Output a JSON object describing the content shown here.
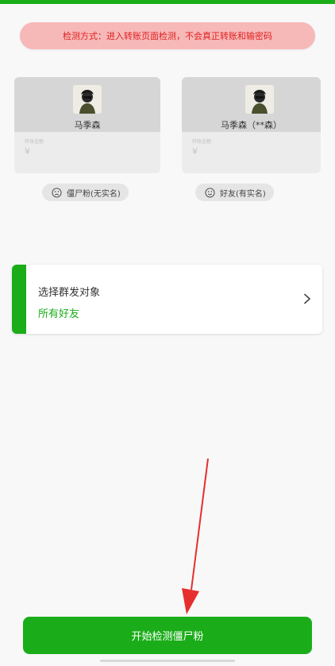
{
  "notice": {
    "text": "检测方式：进入转账页面检测，不会真正转账和输密码"
  },
  "cards": [
    {
      "name": "马季森",
      "small_text": "转账金额",
      "currency": "¥",
      "icon": "profile-photo"
    },
    {
      "name": "马季森（**森）",
      "small_text": "转账金额",
      "currency": "¥",
      "icon": "profile-photo"
    }
  ],
  "pills": [
    {
      "label": "僵尸粉(无实名)",
      "icon": "sad-face-icon"
    },
    {
      "label": "好友(有实名)",
      "icon": "smile-face-icon"
    }
  ],
  "selector": {
    "title": "选择群发对象",
    "value": "所有好友",
    "icon": "chevron-right-icon"
  },
  "start_button": {
    "label": "开始检测僵尸粉"
  },
  "colors": {
    "accent": "#1aad19",
    "notice_bg": "#f7b8b8",
    "notice_text": "#e02020",
    "arrow": "#e62e2e"
  }
}
